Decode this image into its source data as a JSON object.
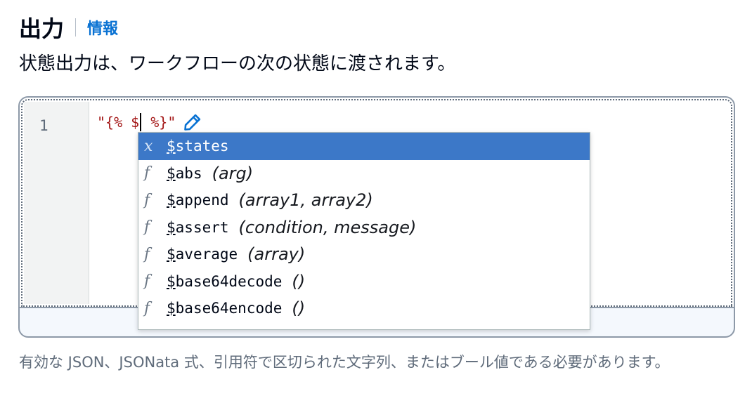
{
  "header": {
    "title": "出力",
    "info_link": "情報"
  },
  "description": "状態出力は、ワークフローの次の状態に渡されます。",
  "editor": {
    "line_number": "1",
    "code_before_cursor": "\"{% $",
    "code_after_cursor": " %}\"",
    "edit_icon": "pencil-icon"
  },
  "autocomplete": {
    "items": [
      {
        "kind": "x",
        "prefix": "$",
        "rest": "states",
        "args": "",
        "selected": true
      },
      {
        "kind": "f",
        "prefix": "$",
        "rest": "abs",
        "args": "(arg)"
      },
      {
        "kind": "f",
        "prefix": "$",
        "rest": "append",
        "args": "(array1, array2)"
      },
      {
        "kind": "f",
        "prefix": "$",
        "rest": "assert",
        "args": "(condition, message)"
      },
      {
        "kind": "f",
        "prefix": "$",
        "rest": "average",
        "args": "(array)"
      },
      {
        "kind": "f",
        "prefix": "$",
        "rest": "base64decode",
        "args": "()"
      },
      {
        "kind": "f",
        "prefix": "$",
        "rest": "base64encode",
        "args": "()"
      }
    ],
    "selected_color": "#3c78c8"
  },
  "help_text": "有効な JSON、JSONata 式、引用符で区切られた文字列、またはブール値である必要があります。",
  "colors": {
    "link": "#0972d3",
    "code_string": "#a31515",
    "border": "#8d99a8"
  }
}
